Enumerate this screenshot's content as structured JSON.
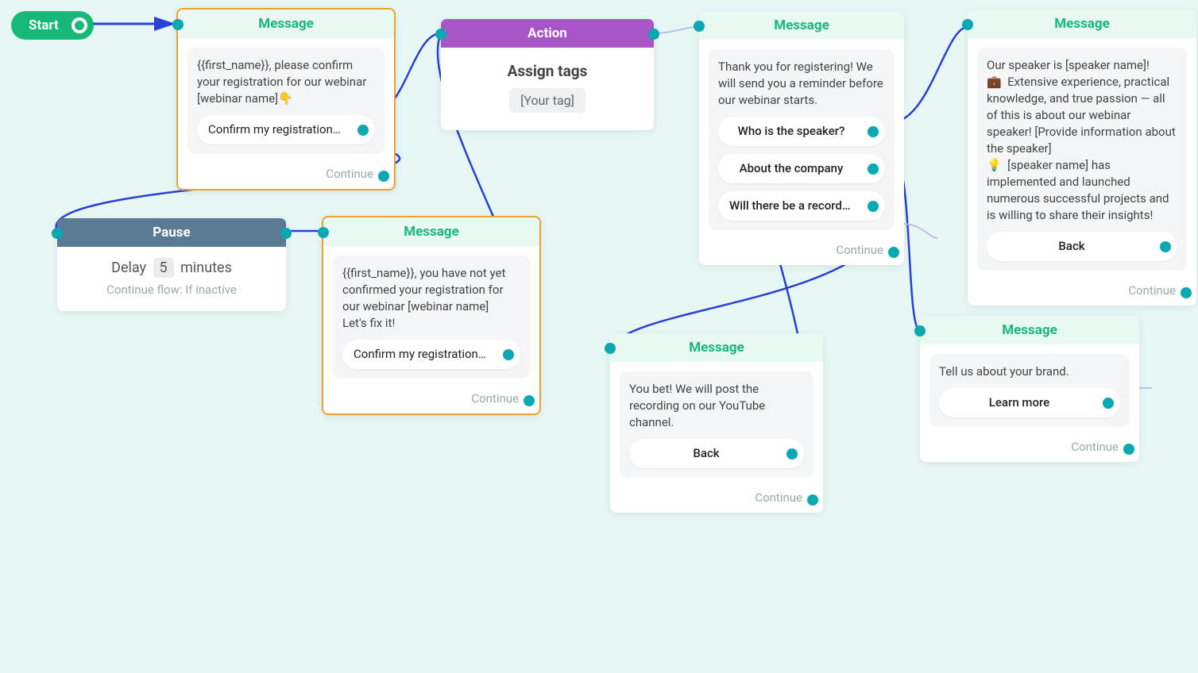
{
  "start": {
    "label": "Start"
  },
  "node1": {
    "header": "Message",
    "text": "{{first_name}}, please confirm your registration for our webinar [webinar name]👇",
    "button": "Confirm my registration ...",
    "continue": "Continue"
  },
  "node2": {
    "header": "Action",
    "title": "Assign tags",
    "tag": "[Your tag]"
  },
  "node3": {
    "header": "Message",
    "text": "Thank you for registering! We will send you a reminder before our webinar starts.",
    "b1": "Who is the speaker?",
    "b2": "About the company",
    "b3": "Will there be a recording?",
    "continue": "Continue"
  },
  "node4": {
    "header": "Message",
    "text": "Our speaker is [speaker name]!\n💼  Extensive experience, practical knowledge, and true passion — all of this is about our webinar speaker! [Provide information about the speaker]\n💡  [speaker name] has implemented and launched numerous successful projects and is willing to share their insights!",
    "button": "Back",
    "continue": "Continue"
  },
  "pause": {
    "header": "Pause",
    "delay_word": "Delay",
    "value": "5",
    "unit": "minutes",
    "sub": "Continue flow: If inactive"
  },
  "node5": {
    "header": "Message",
    "text": "{{first_name}}, you have not yet confirmed your registration for our webinar [webinar name]\nLet's fix it!",
    "button": "Confirm my registration ...",
    "continue": "Continue"
  },
  "node6": {
    "header": "Message",
    "text": "You bet! We will post the recording on our YouTube channel.",
    "button": "Back",
    "continue": "Continue"
  },
  "node7": {
    "header": "Message",
    "text": "Tell us about your brand.",
    "button": "Learn more",
    "continue": "Continue"
  }
}
